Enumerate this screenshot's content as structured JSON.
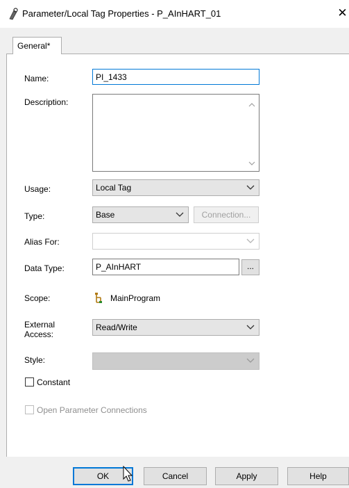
{
  "window": {
    "title": "Parameter/Local Tag Properties - P_AInHART_01",
    "close_glyph": "✕",
    "icon": "tag-properties-icon"
  },
  "tabs": [
    {
      "label": "General*",
      "active": true
    }
  ],
  "form": {
    "name": {
      "label": "Name:",
      "value": "PI_1433"
    },
    "description": {
      "label": "Description:",
      "value": ""
    },
    "usage": {
      "label": "Usage:",
      "value": "Local Tag"
    },
    "type": {
      "label": "Type:",
      "value": "Base",
      "connection_button": "Connection..."
    },
    "alias_for": {
      "label": "Alias For:",
      "value": ""
    },
    "data_type": {
      "label": "Data Type:",
      "value": "P_AInHART",
      "browse_button": "..."
    },
    "scope": {
      "label": "Scope:",
      "value": "MainProgram",
      "icon": "program-icon"
    },
    "external_access": {
      "label_line1": "External",
      "label_line2": "Access:",
      "value": "Read/Write"
    },
    "style": {
      "label": "Style:",
      "value": ""
    },
    "constant": {
      "label": "Constant",
      "checked": false
    },
    "open_param_connections": {
      "label": "Open Parameter Connections",
      "checked": false,
      "enabled": false
    }
  },
  "buttons": {
    "ok": "OK",
    "cancel": "Cancel",
    "apply": "Apply",
    "help": "Help"
  },
  "colors": {
    "focus_border": "#0078d7",
    "disabled_text": "#8f8f8f",
    "window_bg": "#f0f0f0"
  }
}
